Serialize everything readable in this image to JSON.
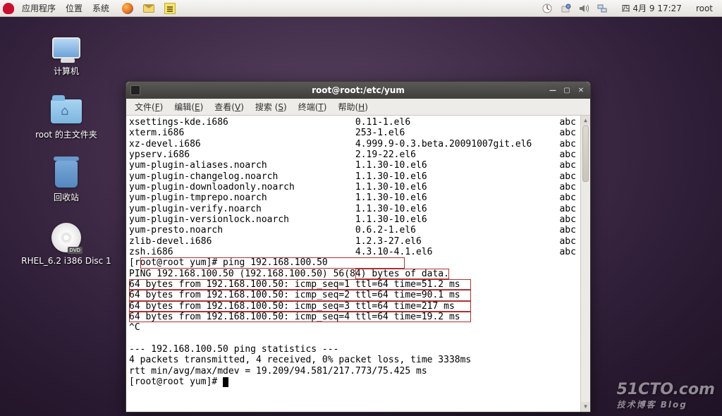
{
  "panel": {
    "menus": {
      "apps": "应用程序",
      "places": "位置",
      "system": "系统"
    },
    "clock": "四 4月  9 17:27",
    "user": "root"
  },
  "desktop": {
    "computer": "计算机",
    "home": "root 的主文件夹",
    "trash": "回收站",
    "disc": "RHEL_6.2 i386 Disc 1"
  },
  "window": {
    "title": "root@root:/etc/yum",
    "menus": {
      "file": "文件",
      "edit": "编辑",
      "view": "查看",
      "search": "搜索",
      "terminal": "终端",
      "help": "帮助"
    },
    "accel": {
      "file": "F",
      "edit": "E",
      "view": "V",
      "search": "S",
      "terminal": "T",
      "help": "H"
    }
  },
  "packages": [
    {
      "name": "xsettings-kde.i686",
      "ver": "0.11-1.el6",
      "repo": "abc"
    },
    {
      "name": "xterm.i686",
      "ver": "253-1.el6",
      "repo": "abc"
    },
    {
      "name": "xz-devel.i686",
      "ver": "4.999.9-0.3.beta.20091007git.el6",
      "repo": "abc"
    },
    {
      "name": "ypserv.i686",
      "ver": "2.19-22.el6",
      "repo": "abc"
    },
    {
      "name": "yum-plugin-aliases.noarch",
      "ver": "1.1.30-10.el6",
      "repo": "abc"
    },
    {
      "name": "yum-plugin-changelog.noarch",
      "ver": "1.1.30-10.el6",
      "repo": "abc"
    },
    {
      "name": "yum-plugin-downloadonly.noarch",
      "ver": "1.1.30-10.el6",
      "repo": "abc"
    },
    {
      "name": "yum-plugin-tmprepo.noarch",
      "ver": "1.1.30-10.el6",
      "repo": "abc"
    },
    {
      "name": "yum-plugin-verify.noarch",
      "ver": "1.1.30-10.el6",
      "repo": "abc"
    },
    {
      "name": "yum-plugin-versionlock.noarch",
      "ver": "1.1.30-10.el6",
      "repo": "abc"
    },
    {
      "name": "yum-presto.noarch",
      "ver": "0.6.2-1.el6",
      "repo": "abc"
    },
    {
      "name": "zlib-devel.i686",
      "ver": "1.2.3-27.el6",
      "repo": "abc"
    },
    {
      "name": "zsh.i686",
      "ver": "4.3.10-4.1.el6",
      "repo": "abc"
    }
  ],
  "ping": {
    "prompt_pre": "[r",
    "prompt_boxed": "oot@root yum]# ping 192.168.100.50",
    "header_pre": "PING 192.168.100.50 (192.168.100.50) 56(8",
    "header_post": "4) bytes of data.",
    "replies": [
      "64 bytes from 192.168.100.50: icmp_seq=1 ttl=64 time=51.2 ms",
      "64 bytes from 192.168.100.50: icmp_seq=2 ttl=64 time=90.1 ms",
      "64 bytes from 192.168.100.50: icmp_seq=3 ttl=64 time=217 ms",
      "64 bytes from 192.168.100.50: icmp_seq=4 ttl=64 time=19.2 ms"
    ],
    "ctrlc": "^C",
    "stats_header": "--- 192.168.100.50 ping statistics ---",
    "stats_line": "4 packets transmitted, 4 received, 0% packet loss, time 3338ms",
    "rtt": "rtt min/avg/max/mdev = 19.209/94.581/217.773/75.425 ms",
    "final_prompt": "[root@root yum]# "
  },
  "watermark": {
    "main": "51CTO.com",
    "sub": "技术博客  Blog"
  }
}
